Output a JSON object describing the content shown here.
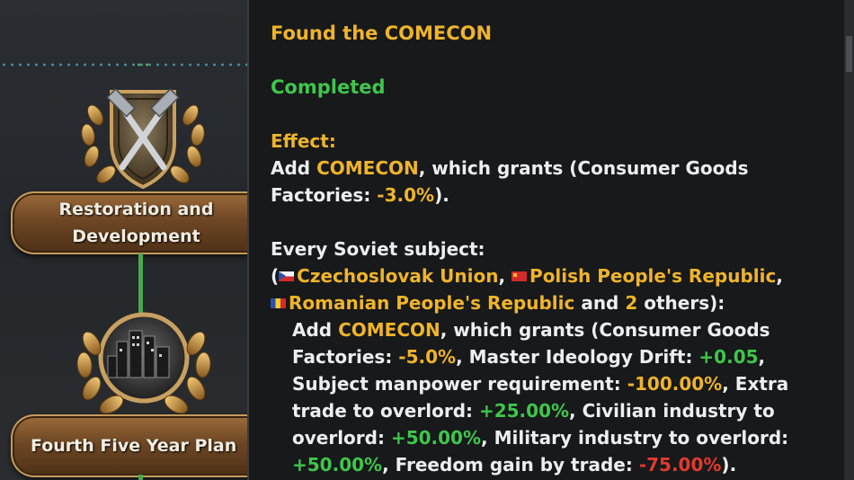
{
  "focus_tree": {
    "nodes": [
      {
        "label_line1": "Restoration and",
        "label_line2": "Development",
        "icon": "crossed-hammers-icon"
      },
      {
        "label_line1": "Fourth Five Year Plan",
        "label_line2": "",
        "icon": "city-wreath-icon"
      }
    ]
  },
  "tooltip": {
    "title": "Found the COMECON",
    "status": "Completed",
    "effect_header": "Effect:",
    "effect1": {
      "pre": "Add ",
      "name": "COMECON",
      "mid": ", which grants (Consumer Goods",
      "line2_pre": "Factories: ",
      "value": "-3.0%",
      "line2_post": ")."
    },
    "subjects": {
      "header": "Every Soviet subject:",
      "open_paren": "(",
      "country1": "Czechoslovak Union",
      "sep1": ", ",
      "country2": "Polish People's Republic",
      "sep2": ",",
      "country3": "Romanian People's Republic",
      "and_text": " and ",
      "count": "2",
      "others_text": " others):"
    },
    "effect2": {
      "l1_pre": "Add ",
      "l1_name": "COMECON",
      "l1_post": ", which grants (Consumer Goods",
      "l2_pre": "Factories: ",
      "l2_v1": "-5.0%",
      "l2_mid": ", Master Ideology Drift: ",
      "l2_v2": "+0.05",
      "l2_post": ",",
      "l3_pre": "Subject manpower requirement: ",
      "l3_v": "-100.00%",
      "l3_post": ", Extra",
      "l4_pre": "trade to overlord: ",
      "l4_v": "+25.00%",
      "l4_post": ", Civilian industry to",
      "l5_pre": "overlord: ",
      "l5_v": "+50.00%",
      "l5_post": ", Military industry to overlord:",
      "l6_v1": "+50.00%",
      "l6_mid": ", Freedom gain by trade: ",
      "l6_v2": "-75.00%",
      "l6_post": ")."
    }
  },
  "colors": {
    "yellow": "#f0b42a",
    "green": "#3fc64a",
    "red": "#e23a2e",
    "text": "#eceff0",
    "tooltip_bg": "#17191b"
  }
}
